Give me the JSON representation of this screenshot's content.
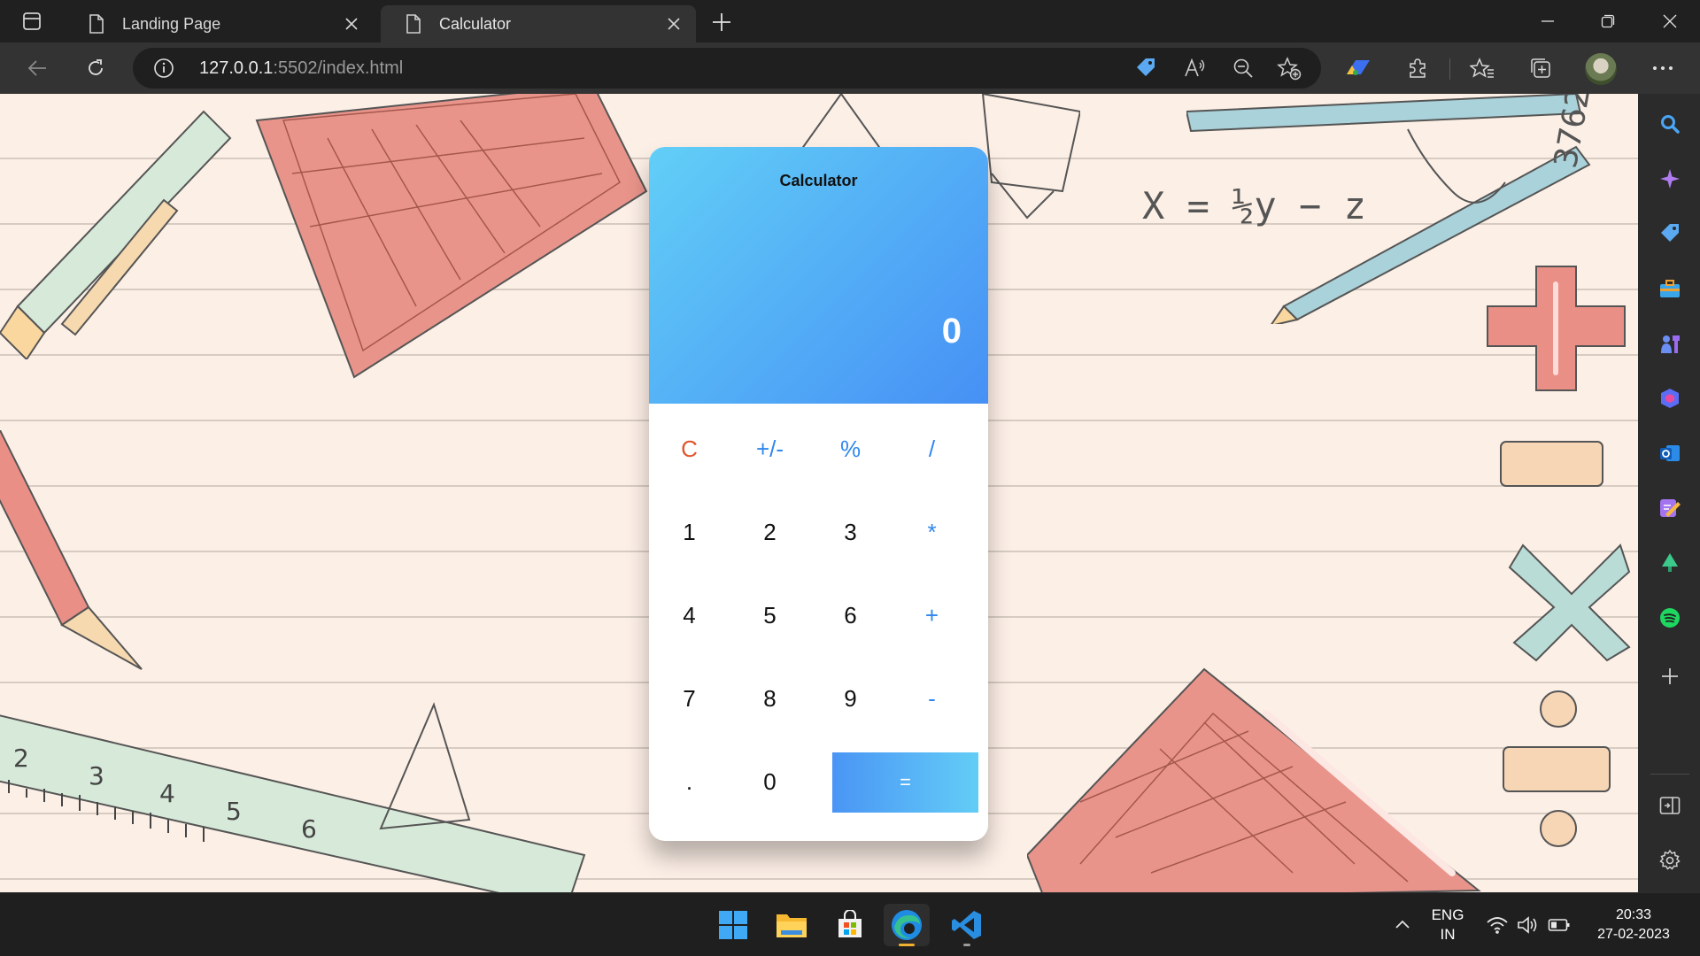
{
  "browser": {
    "tabs": [
      {
        "title": "Landing Page",
        "active": false
      },
      {
        "title": "Calculator",
        "active": true
      }
    ],
    "url_host": "127.0.0.1",
    "url_rest": ":5502/index.html"
  },
  "calculator": {
    "title": "Calculator",
    "display_value": "0",
    "keys": [
      {
        "label": "C",
        "kind": "clear"
      },
      {
        "label": "+/-",
        "kind": "op"
      },
      {
        "label": "%",
        "kind": "op"
      },
      {
        "label": "/",
        "kind": "op"
      },
      {
        "label": "1",
        "kind": "num"
      },
      {
        "label": "2",
        "kind": "num"
      },
      {
        "label": "3",
        "kind": "num"
      },
      {
        "label": "*",
        "kind": "op"
      },
      {
        "label": "4",
        "kind": "num"
      },
      {
        "label": "5",
        "kind": "num"
      },
      {
        "label": "6",
        "kind": "num"
      },
      {
        "label": "+",
        "kind": "op"
      },
      {
        "label": "7",
        "kind": "num"
      },
      {
        "label": "8",
        "kind": "num"
      },
      {
        "label": "9",
        "kind": "num"
      },
      {
        "label": "-",
        "kind": "op"
      },
      {
        "label": ".",
        "kind": "num"
      },
      {
        "label": "0",
        "kind": "num"
      },
      {
        "label": "=",
        "kind": "eq"
      }
    ],
    "colors": {
      "gradient_start": "#62cff7",
      "gradient_end": "#4690f5",
      "operator": "#2f87ef",
      "clear": "#e0552d"
    }
  },
  "background_text": {
    "formula": "X = ½y − z",
    "number": "3762"
  },
  "taskbar": {
    "language": "ENG",
    "region": "IN",
    "time": "20:33",
    "date": "27-02-2023"
  },
  "icons": {
    "sidebar": [
      "search-icon",
      "copilot-icon",
      "shopping-tag-icon",
      "tools-icon",
      "games-icon",
      "office-icon",
      "outlook-icon",
      "designer-icon",
      "tree-icon",
      "spotify-icon",
      "add-icon",
      "split-screen-icon",
      "settings-icon"
    ],
    "taskbar": [
      "windows-start-icon",
      "file-explorer-icon",
      "microsoft-store-icon",
      "edge-icon",
      "vscode-icon"
    ]
  }
}
